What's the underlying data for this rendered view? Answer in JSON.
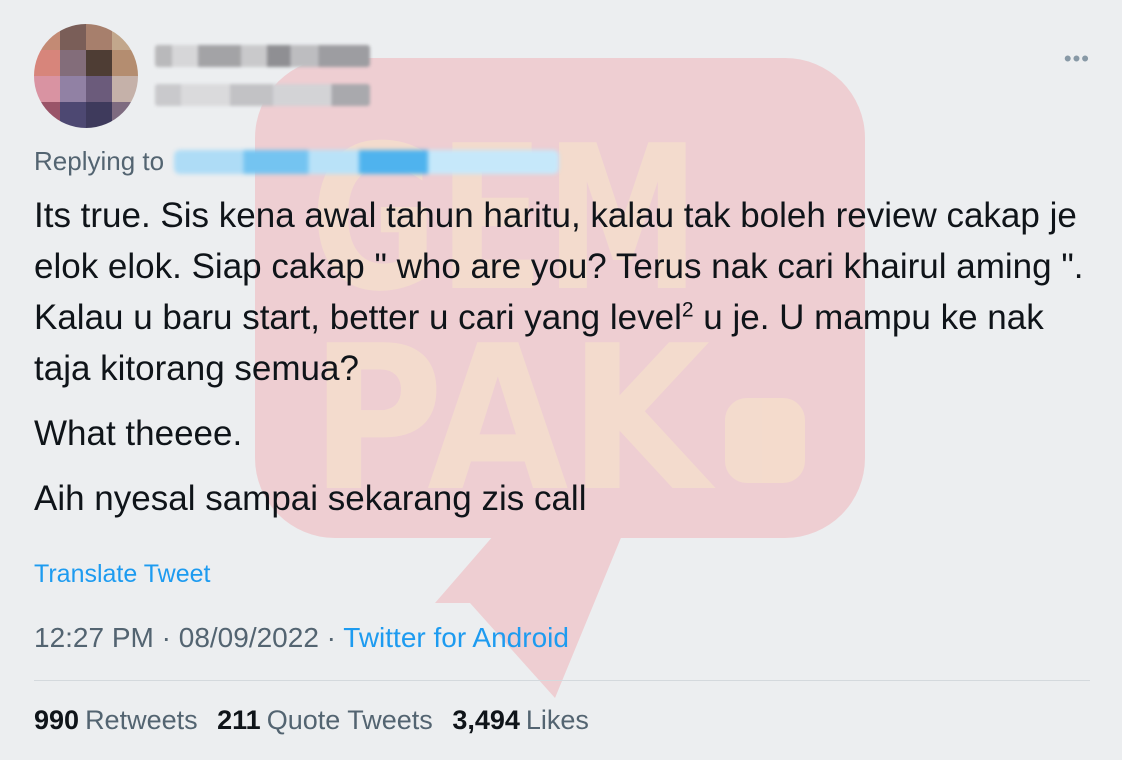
{
  "tweet": {
    "replying_to_label": "Replying to",
    "more_icon": "more-horizontal-icon",
    "body": {
      "paragraph1_a": "Its true. Sis kena awal tahun haritu, kalau tak boleh review cakap je elok elok. Siap cakap \" who are you? Terus nak cari khairul aming \". Kalau u baru start, better u cari yang level",
      "paragraph1_sup": "2",
      "paragraph1_b": " u je. U mampu ke nak taja kitorang semua?",
      "paragraph2": "What theeee.",
      "paragraph3": "Aih nyesal sampai sekarang zis call"
    },
    "translate_label": "Translate Tweet",
    "time": "12:27 PM",
    "separator": " · ",
    "date": "08/09/2022",
    "source": "Twitter for Android",
    "stats": {
      "retweets_count": "990",
      "retweets_label": "Retweets",
      "quotes_count": "211",
      "quotes_label": "Quote Tweets",
      "likes_count": "3,494",
      "likes_label": "Likes"
    }
  },
  "watermark": {
    "line1": "GEM",
    "line2": "PAK",
    "color": "#f47d86"
  },
  "colors": {
    "background": "#eceef0",
    "accent": "#1d9bf0",
    "secondary_text": "#536471"
  }
}
